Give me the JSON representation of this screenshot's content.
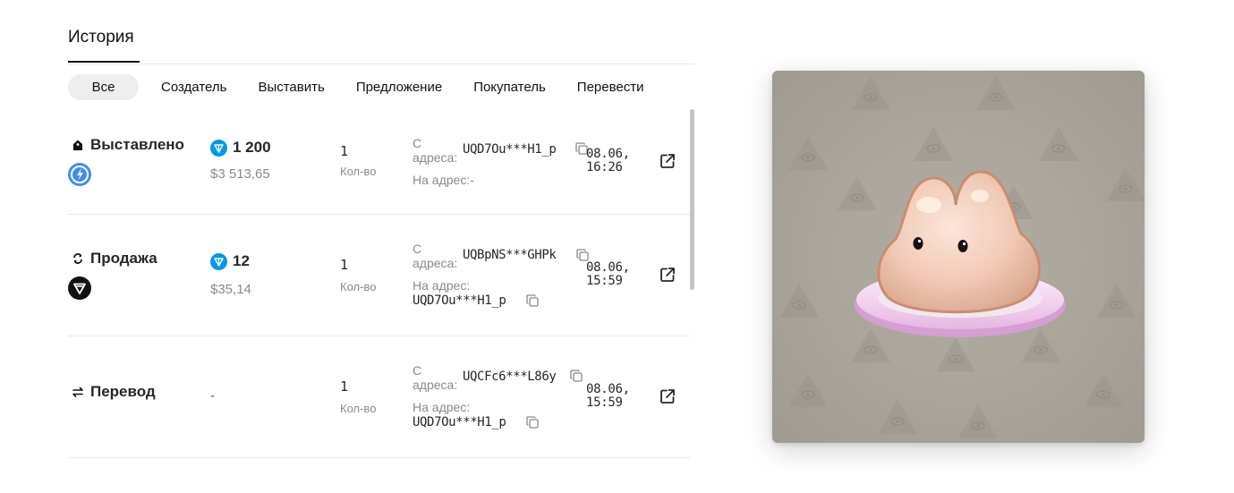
{
  "history": {
    "tab_label": "История",
    "filters": [
      "Все",
      "Создатель",
      "Выставить",
      "Предложение",
      "Покупатель",
      "Перевести"
    ],
    "active_filter": "Все",
    "rows": [
      {
        "type": "Выставлено",
        "type_icon": "listing-tag-icon",
        "marketplace_icon": "marketplace-blue-icon",
        "price_ton": "1 200",
        "price_usd": "$3 513,65",
        "quantity": "1",
        "quantity_label": "Кол-во",
        "from_label": "С адреса:",
        "from_address": "UQD7Ou***H1_p",
        "to_label": "На адрес:",
        "to_address": "-",
        "date": "08.06,",
        "time": "16:26"
      },
      {
        "type": "Продажа",
        "type_icon": "sale-arrows-icon",
        "marketplace_icon": "marketplace-black-icon",
        "price_ton": "12",
        "price_usd": "$35,14",
        "quantity": "1",
        "quantity_label": "Кол-во",
        "from_label": "С адреса:",
        "from_address": "UQBpNS***GHPk",
        "to_label": "На адрес:",
        "to_address": "UQD7Ou***H1_p",
        "date": "08.06,",
        "time": "15:59"
      },
      {
        "type": "Перевод",
        "type_icon": "transfer-arrows-icon",
        "price_placeholder": "-",
        "quantity": "1",
        "quantity_label": "Кол-во",
        "from_label": "С адреса:",
        "from_address": "UQCFc6***L86y",
        "to_label": "На адрес:",
        "to_address": "UQD7Ou***H1_p",
        "date": "08.06,",
        "time": "15:59"
      }
    ]
  },
  "icons": {
    "currency": "ton-diamond-icon",
    "copy": "copy-icon",
    "external_link": "external-link-icon"
  },
  "colors": {
    "ton_blue": "#0098ea",
    "marketplace_blue": "#3e8ef0",
    "muted_text": "#8a8a8a",
    "art_background": "#a8a39a"
  }
}
